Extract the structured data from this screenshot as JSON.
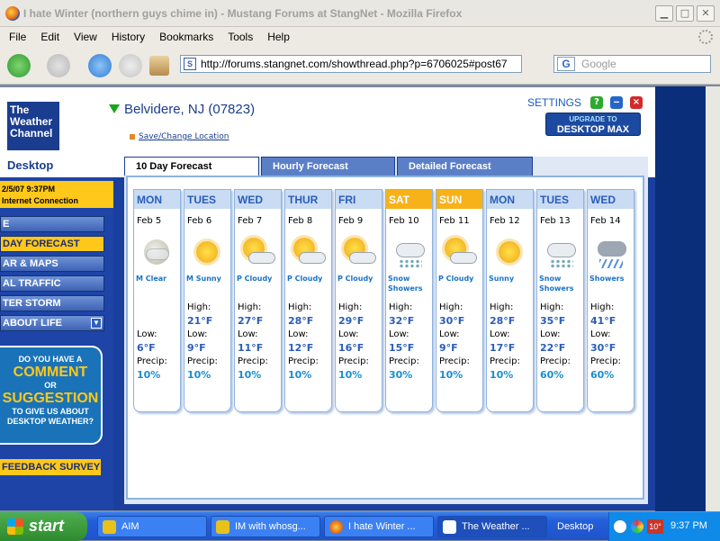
{
  "browser": {
    "title": "I hate Winter (northern guys chime in) - Mustang Forums at StangNet - Mozilla Firefox",
    "menu": [
      "File",
      "Edit",
      "View",
      "History",
      "Bookmarks",
      "Tools",
      "Help"
    ],
    "url": "http://forums.stangnet.com/showthread.php?p=6706025#post67",
    "search_placeholder": "Google"
  },
  "widget": {
    "brand_line1": "The",
    "brand_line2": "Weather",
    "brand_line3": "Channel",
    "brand_sub": "Desktop",
    "location": "Belvidere, NJ (07823)",
    "save_location": "Save/Change Location",
    "settings": "SETTINGS",
    "upgrade_line1": "UPGRADE TO",
    "upgrade_line2": "DESKTOP MAX",
    "datetime": "2/5/07 9:37PM",
    "connection": "Internet Connection",
    "nav": [
      "E",
      "DAY FORECAST",
      "AR & MAPS",
      "AL TRAFFIC",
      "TER STORM",
      "ABOUT LIFE"
    ],
    "comment": {
      "l1": "DO YOU HAVE A",
      "l2": "COMMENT",
      "l3": "OR",
      "l4": "SUGGESTION",
      "l5": "TO GIVE US ABOUT",
      "l6": "DESKTOP WEATHER?"
    },
    "survey": "FEEDBACK SURVEY",
    "tabs": [
      "10 Day Forecast",
      "Hourly Forecast",
      "Detailed Forecast"
    ],
    "labels": {
      "high": "High:",
      "low": "Low:",
      "precip": "Precip:"
    },
    "days": [
      {
        "day": "MON",
        "date": "Feb 5",
        "icon": "moon-clear-icon",
        "cond": "M Clear",
        "high": "",
        "low": "6°F",
        "precip": "10%",
        "weekend": false
      },
      {
        "day": "TUES",
        "date": "Feb 6",
        "icon": "sunny-icon",
        "cond": "M Sunny",
        "high": "21°F",
        "low": "9°F",
        "precip": "10%",
        "weekend": false
      },
      {
        "day": "WED",
        "date": "Feb 7",
        "icon": "partly-cloudy-icon",
        "cond": "P Cloudy",
        "high": "27°F",
        "low": "11°F",
        "precip": "10%",
        "weekend": false
      },
      {
        "day": "THUR",
        "date": "Feb 8",
        "icon": "partly-cloudy-icon",
        "cond": "P Cloudy",
        "high": "28°F",
        "low": "12°F",
        "precip": "10%",
        "weekend": false
      },
      {
        "day": "FRI",
        "date": "Feb 9",
        "icon": "partly-cloudy-icon",
        "cond": "P Cloudy",
        "high": "29°F",
        "low": "16°F",
        "precip": "10%",
        "weekend": false
      },
      {
        "day": "SAT",
        "date": "Feb 10",
        "icon": "snow-showers-icon",
        "cond": "Snow Showers",
        "high": "32°F",
        "low": "15°F",
        "precip": "30%",
        "weekend": true
      },
      {
        "day": "SUN",
        "date": "Feb 11",
        "icon": "partly-cloudy-icon",
        "cond": "P Cloudy",
        "high": "30°F",
        "low": "9°F",
        "precip": "10%",
        "weekend": true
      },
      {
        "day": "MON",
        "date": "Feb 12",
        "icon": "sunny-icon",
        "cond": "Sunny",
        "high": "28°F",
        "low": "17°F",
        "precip": "10%",
        "weekend": false
      },
      {
        "day": "TUES",
        "date": "Feb 13",
        "icon": "snow-showers-icon",
        "cond": "Snow Showers",
        "high": "35°F",
        "low": "22°F",
        "precip": "60%",
        "weekend": false
      },
      {
        "day": "WED",
        "date": "Feb 14",
        "icon": "showers-icon",
        "cond": "Showers",
        "high": "41°F",
        "low": "30°F",
        "precip": "60%",
        "weekend": false
      }
    ]
  },
  "taskbar": {
    "start": "start",
    "tasks": [
      "AIM",
      "IM with whosg...",
      "I hate Winter ...",
      "The Weather ..."
    ],
    "desktop": "Desktop",
    "temp": "10°",
    "clock": "9:37 PM"
  }
}
